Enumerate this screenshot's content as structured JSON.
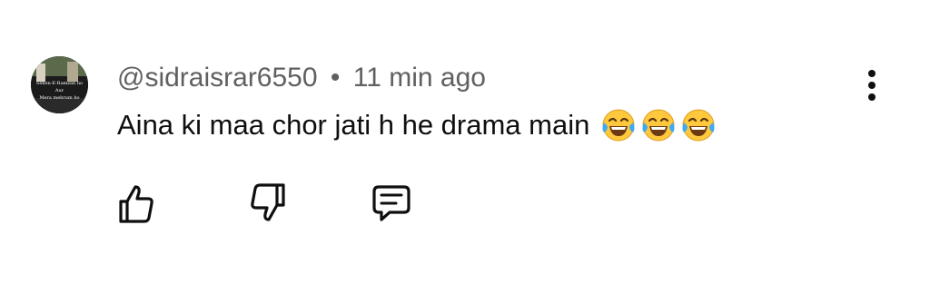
{
  "comment": {
    "author": "@sidraisrar6550",
    "separator": "•",
    "timestamp": "11 min ago",
    "text": "Aina ki maa chor jati h he drama main",
    "emojis": [
      "face-with-tears-of-joy",
      "face-with-tears-of-joy",
      "face-with-tears-of-joy"
    ]
  },
  "avatar": {
    "lines": [
      "Sehen-E-Ramzan ho",
      "Aur",
      "Mera mehrum ho"
    ]
  },
  "actions": {
    "like_icon": "thumbs-up-icon",
    "dislike_icon": "thumbs-down-icon",
    "reply_icon": "reply-comment-icon",
    "more_icon": "more-vertical-icon"
  },
  "colors": {
    "text": "#0f0f0f",
    "meta": "#606060",
    "emoji_face": "#ffc83d",
    "emoji_tear": "#3fa9f5"
  }
}
